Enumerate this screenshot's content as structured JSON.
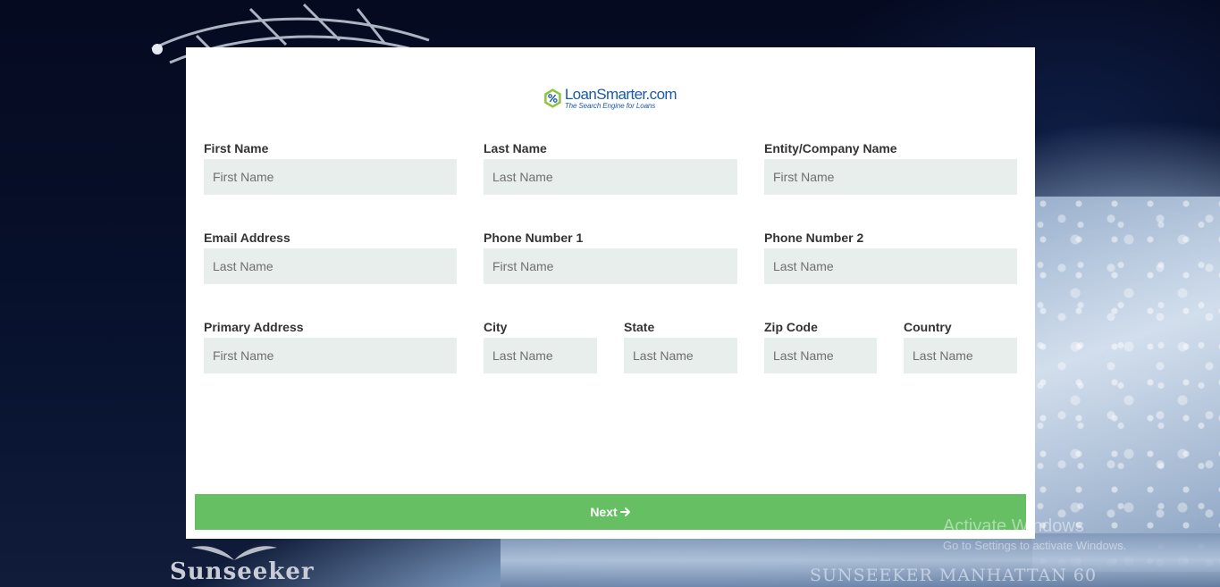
{
  "logo": {
    "name": "LoanSmarter.com",
    "tagline": "The Search Engine for Loans",
    "icon": "percent-hexagon-icon",
    "accent": "#1a5aa8",
    "hex_color": "#8cc63f"
  },
  "form": {
    "fields": [
      {
        "label": "First Name",
        "placeholder": "First Name"
      },
      {
        "label": "Last Name",
        "placeholder": "Last Name"
      },
      {
        "label": "Entity/Company Name",
        "placeholder": "First Name"
      },
      {
        "label": "Email Address",
        "placeholder": "Last Name"
      },
      {
        "label": "Phone Number 1",
        "placeholder": "First Name"
      },
      {
        "label": "Phone Number 2",
        "placeholder": "Last Name"
      },
      {
        "label": "Primary Address",
        "placeholder": "First Name"
      },
      {
        "label": "City",
        "placeholder": "Last Name"
      },
      {
        "label": "State",
        "placeholder": "Last Name"
      },
      {
        "label": "Zip Code",
        "placeholder": "Last Name"
      },
      {
        "label": "Country",
        "placeholder": "Last Name"
      }
    ],
    "next_label": "Next",
    "next_icon": "arrow-right-icon",
    "button_color": "#66bf63",
    "input_bg": "#e8eeec"
  },
  "background": {
    "brand": "Sunseeker",
    "boat_name": "SUNSEEKER MANHATTAN 60"
  },
  "watermark": {
    "title": "Activate Windows",
    "subtitle": "Go to Settings to activate Windows."
  }
}
